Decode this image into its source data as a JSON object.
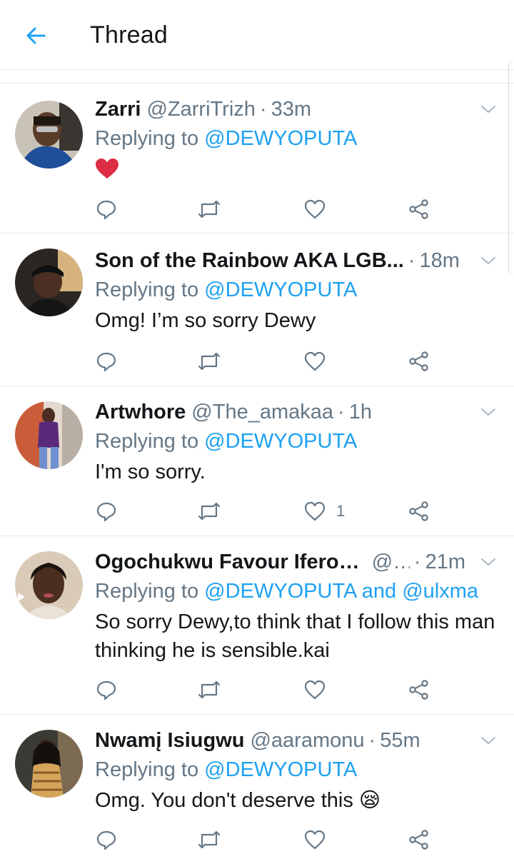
{
  "header": {
    "title": "Thread"
  },
  "reply_prefix": "Replying to",
  "colors": {
    "accent": "#1da1f2",
    "muted": "#657786",
    "text": "#14171a",
    "divider": "#e1e8ed",
    "heart": "#e0245e"
  },
  "tweets": [
    {
      "name": "Zarri",
      "handle": "@ZarriTrizh",
      "time": "33m",
      "mentions": "@DEWYOPUTA",
      "text": "",
      "emoji": "heart-emoji",
      "likes": ""
    },
    {
      "name": "Son of the Rainbow AKA LGB...",
      "handle": "",
      "time": "18m",
      "mentions": "@DEWYOPUTA",
      "text": "Omg! I’m so sorry Dewy",
      "likes": ""
    },
    {
      "name": "Artwhore",
      "handle": "@The_amakaa",
      "time": "1h",
      "mentions": "@DEWYOPUTA",
      "text": "I'm so sorry.",
      "likes": "1"
    },
    {
      "name": "Ogochukwu Favour Iferobia",
      "handle": "@...",
      "time": "21m",
      "mentions": "@DEWYOPUTA and @ulxma",
      "text": "So sorry Dewy,to think that I follow this man thinking he is sensible.kai",
      "likes": ""
    },
    {
      "name": "Nwamį Isiugwu",
      "handle": "@aaramonu",
      "time": "55m",
      "mentions": "@DEWYOPUTA",
      "text": "Omg. You don't deserve this 😪",
      "likes": ""
    }
  ]
}
